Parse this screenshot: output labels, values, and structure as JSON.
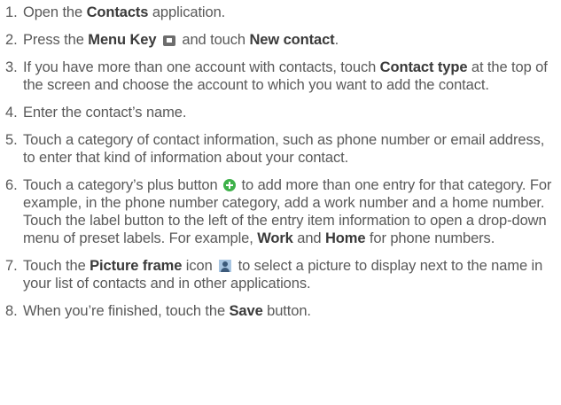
{
  "steps": [
    {
      "number": "1.",
      "parts": [
        "Open the ",
        "Contacts",
        " application."
      ]
    },
    {
      "number": "2.",
      "parts": [
        "Press  the ",
        "Menu Key",
        " and touch ",
        "New contact",
        "."
      ]
    },
    {
      "number": "3.",
      "parts": [
        "If you have more than one account with contacts, touch ",
        "Contact type",
        " at the top of the screen and choose the account to which you want to add the contact."
      ]
    },
    {
      "number": "4.",
      "parts": [
        "Enter the contact’s name."
      ]
    },
    {
      "number": "5.",
      "parts": [
        "Touch a category of contact information, such as phone number or email address, to enter that kind of information about your contact."
      ]
    },
    {
      "number": "6.",
      "parts": [
        "Touch a category’s plus button",
        " to add more than one entry for that category. For example, in the phone number category, add a work number and a home number. Touch the label button to the left of the entry item information to open a drop-down menu of preset labels. For example, ",
        "Work",
        " and ",
        "Home",
        " for phone numbers."
      ]
    },
    {
      "number": "7.",
      "parts": [
        "Touch the ",
        "Picture frame",
        " icon",
        " to select a picture to display next to the name in your list of contacts and in other applications."
      ]
    },
    {
      "number": "8.",
      "parts": [
        "When you’re finished, touch the ",
        "Save",
        " button."
      ]
    }
  ],
  "icons": {
    "menu_key": "menu-key-icon",
    "plus_button": "plus-circle-icon",
    "picture_frame": "picture-frame-icon"
  },
  "colors": {
    "text": "#595959",
    "bold_text": "#3a3a3a",
    "plus_icon": "#3eb14a",
    "picture_icon": "#a9c6e2"
  }
}
